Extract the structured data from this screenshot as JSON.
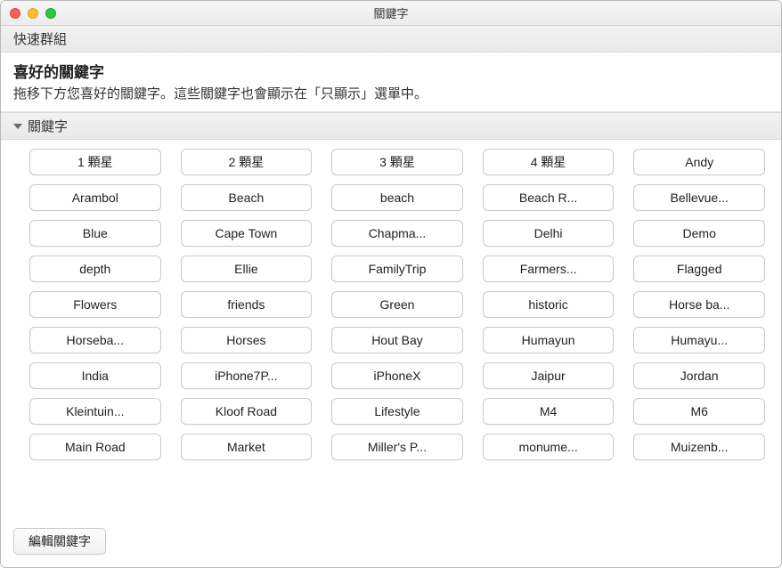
{
  "window": {
    "title": "關鍵字"
  },
  "sections": {
    "quick_group_header": "快速群組",
    "favorites": {
      "title": "喜好的關鍵字",
      "description": "拖移下方您喜好的關鍵字。這些關鍵字也會顯示在「只顯示」選單中。"
    },
    "keywords_header": "關鍵字"
  },
  "keywords": [
    "1 顆星",
    "2 顆星",
    "3 顆星",
    "4 顆星",
    "Andy",
    "Arambol",
    "Beach",
    "beach",
    "Beach R...",
    "Bellevue...",
    "Blue",
    "Cape Town",
    "Chapma...",
    "Delhi",
    "Demo",
    "depth",
    "Ellie",
    "FamilyTrip",
    "Farmers...",
    "Flagged",
    "Flowers",
    "friends",
    "Green",
    "historic",
    "Horse ba...",
    "Horseba...",
    "Horses",
    "Hout Bay",
    "Humayun",
    "Humayu...",
    "India",
    "iPhone7P...",
    "iPhoneX",
    "Jaipur",
    "Jordan",
    "Kleintuin...",
    "Kloof Road",
    "Lifestyle",
    "M4",
    "M6",
    "Main Road",
    "Market",
    "Miller's P...",
    "monume...",
    "Muizenb..."
  ],
  "footer": {
    "edit_label": "編輯關鍵字"
  }
}
